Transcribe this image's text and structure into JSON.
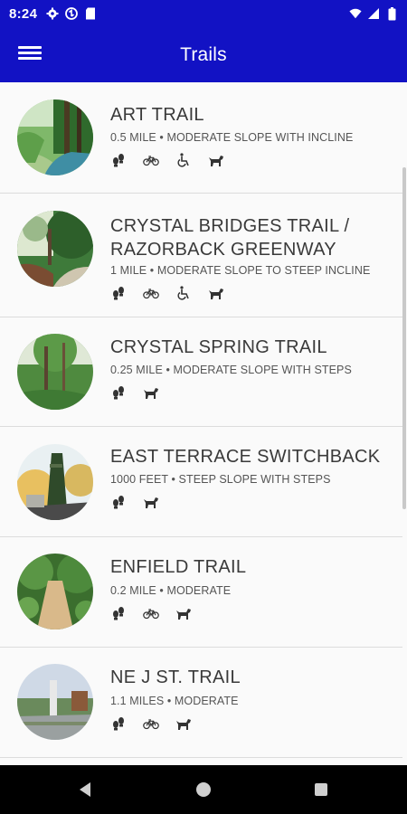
{
  "status_bar": {
    "time": "8:24",
    "left_icons": [
      "gear-icon",
      "sync-icon",
      "sd-card-icon"
    ],
    "right_icons": [
      "wifi-icon",
      "signal-icon",
      "battery-icon"
    ]
  },
  "app_bar": {
    "title": "Trails",
    "color": "#1212c4",
    "menu_icon": "hamburger-menu-icon"
  },
  "trails": [
    {
      "name_lines": [
        "ART TRAIL"
      ],
      "meta": "0.5 MILE • MODERATE SLOPE WITH INCLINE",
      "icons": [
        "hiking-icon",
        "bike-icon",
        "wheelchair-icon",
        "dog-icon"
      ]
    },
    {
      "name_lines": [
        "CRYSTAL BRIDGES TRAIL /",
        "RAZORBACK GREENWAY"
      ],
      "meta": "1 MILE • MODERATE SLOPE TO STEEP INCLINE",
      "icons": [
        "hiking-icon",
        "bike-icon",
        "wheelchair-icon",
        "dog-icon"
      ]
    },
    {
      "name_lines": [
        "CRYSTAL SPRING TRAIL"
      ],
      "meta": "0.25 MILE • MODERATE SLOPE WITH STEPS",
      "icons": [
        "hiking-icon",
        "dog-icon"
      ]
    },
    {
      "name_lines": [
        "EAST TERRACE SWITCHBACK"
      ],
      "meta": "1000 FEET • STEEP SLOPE WITH STEPS",
      "icons": [
        "hiking-icon",
        "dog-icon"
      ]
    },
    {
      "name_lines": [
        "ENFIELD TRAIL"
      ],
      "meta": "0.2 MILE • MODERATE",
      "icons": [
        "hiking-icon",
        "bike-icon",
        "dog-icon"
      ]
    },
    {
      "name_lines": [
        "NE J ST. TRAIL"
      ],
      "meta": "1.1 MILES • MODERATE",
      "icons": [
        "hiking-icon",
        "bike-icon",
        "dog-icon"
      ]
    }
  ],
  "nav_bar": {
    "buttons": [
      "back-icon",
      "home-icon",
      "recents-icon"
    ]
  }
}
